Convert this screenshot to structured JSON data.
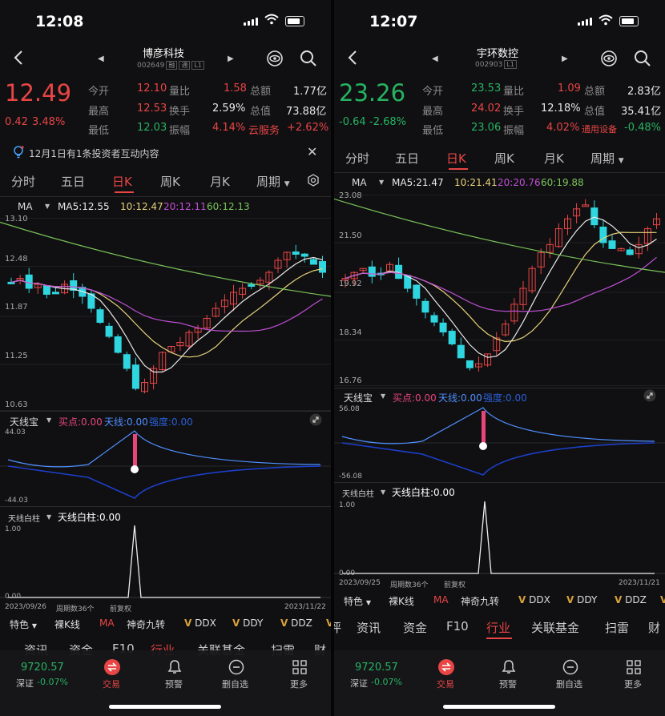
{
  "left": {
    "status_time": "12:08",
    "stock_name": "博彦科技",
    "stock_code": "002649",
    "badge1": "融",
    "badge2": "通",
    "badge3": "L1",
    "price": "12.49",
    "change": "0.42",
    "change_pct": "3.48%",
    "stats": {
      "open_label": "今开",
      "open_value": "12.10",
      "vol_ratio_label": "量比",
      "vol_ratio_value": "1.58",
      "amount_label": "总额",
      "amount_value": "1.77亿",
      "high_label": "最高",
      "high_value": "12.53",
      "turnover_label": "换手",
      "turnover_value": "2.59%",
      "mktcap_label": "总值",
      "mktcap_value": "73.88亿",
      "low_label": "最低",
      "low_value": "12.03",
      "amplitude_label": "振幅",
      "amplitude_value": "4.14%",
      "sector_name": "云服务",
      "sector_change": "+2.62%"
    },
    "notice": "12月1日有1条投资者互动内容",
    "tabs": [
      "分时",
      "五日",
      "日K",
      "周K",
      "月K",
      "周期"
    ],
    "ma": {
      "label": "MA",
      "ma5": "MA5:12.55",
      "ma10": "10:12.47",
      "ma20": "20:12.11",
      "ma60": "60:12.13"
    },
    "yticks": [
      "13.10",
      "12.48",
      "11.87",
      "11.25",
      "10.63"
    ],
    "indicator1": {
      "name": "天线宝",
      "buy": "买点:0.00",
      "antenna": "天线:0.00",
      "extra": "强度:0.00",
      "top": "44.03",
      "bottom": "-44.03"
    },
    "indicator2": {
      "name": "天线白柱",
      "value": "天线白柱:0.00",
      "top": "1.00",
      "bottom": "0.00"
    },
    "date_start": "2023/09/26",
    "period_count": "周期数36个",
    "adj": "前复权",
    "date_end": "2023/11/22",
    "chips": [
      "特色",
      "裸K线",
      "MA",
      "神奇九转",
      "DDX",
      "DDY",
      "DDZ"
    ],
    "info_tabs": [
      "资讯",
      "资金",
      "F10",
      "行业",
      "关联基金",
      "扫雷",
      "财"
    ],
    "index_value": "9720.57",
    "index_name": "深证",
    "index_change": "-0.07%",
    "nav": [
      "交易",
      "预警",
      "删自选",
      "更多"
    ]
  },
  "right": {
    "status_time": "12:07",
    "stock_name": "宇环数控",
    "stock_code": "002903",
    "badge3": "L1",
    "price": "23.26",
    "change": "-0.64",
    "change_pct": "-2.68%",
    "stats": {
      "open_label": "今开",
      "open_value": "23.53",
      "vol_ratio_label": "量比",
      "vol_ratio_value": "1.09",
      "amount_label": "总额",
      "amount_value": "2.83亿",
      "high_label": "最高",
      "high_value": "24.02",
      "turnover_label": "换手",
      "turnover_value": "12.18%",
      "mktcap_label": "总值",
      "mktcap_value": "35.41亿",
      "low_label": "最低",
      "low_value": "23.06",
      "amplitude_label": "振幅",
      "amplitude_value": "4.02%",
      "sector_name": "通用设备",
      "sector_change": "-0.48%"
    },
    "tabs": [
      "分时",
      "五日",
      "日K",
      "周K",
      "月K",
      "周期"
    ],
    "ma": {
      "label": "MA",
      "ma5": "MA5:21.47",
      "ma10": "10:21.41",
      "ma20": "20:20.76",
      "ma60": "60:19.88"
    },
    "yticks": [
      "23.08",
      "21.50",
      "19.92",
      "18.34",
      "16.76"
    ],
    "indicator1": {
      "name": "天线宝",
      "buy": "买点:0.00",
      "antenna": "天线:0.00",
      "extra": "强度:0.00",
      "top": "56.08",
      "bottom": "-56.08"
    },
    "indicator2": {
      "name": "天线白柱",
      "value": "天线白柱:0.00",
      "top": "1.00",
      "bottom": "0.00"
    },
    "date_start": "2023/09/25",
    "period_count": "周期数36个",
    "adj": "前复权",
    "date_end": "2023/11/21",
    "chips": [
      "特色",
      "裸K线",
      "MA",
      "神奇九转",
      "DDX",
      "DDY",
      "DDZ"
    ],
    "info_tabs": [
      "评",
      "资讯",
      "资金",
      "F10",
      "行业",
      "关联基金",
      "扫雷",
      "财"
    ],
    "index_value": "9720.57",
    "index_name": "深证",
    "index_change": "-0.07%",
    "nav": [
      "交易",
      "预警",
      "删自选",
      "更多"
    ]
  },
  "colors": {
    "up": "#e84545",
    "down": "#2fd6e0",
    "ma5": "#e8e8e8",
    "ma10": "#e6d27a",
    "ma20": "#c04fd6",
    "ma60": "#7bc45a",
    "accent": "#e84545"
  }
}
